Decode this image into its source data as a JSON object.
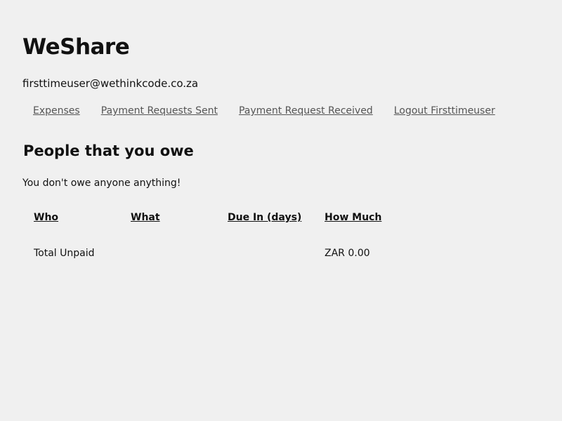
{
  "app": {
    "title": "WeShare",
    "user_email": "firsttimeuser@wethinkcode.co.za"
  },
  "nav": {
    "items": [
      {
        "label": "Expenses"
      },
      {
        "label": "Payment Requests Sent"
      },
      {
        "label": "Payment Request Received"
      },
      {
        "label": "Logout Firsttimeuser"
      }
    ]
  },
  "owe_section": {
    "title": "People that you owe",
    "message": "You don't owe anyone anything!",
    "table": {
      "headers": [
        "Who",
        "What",
        "Due In (days)",
        "How Much"
      ],
      "total_row": {
        "label": "Total Unpaid",
        "amount": "ZAR 0.00"
      }
    }
  }
}
